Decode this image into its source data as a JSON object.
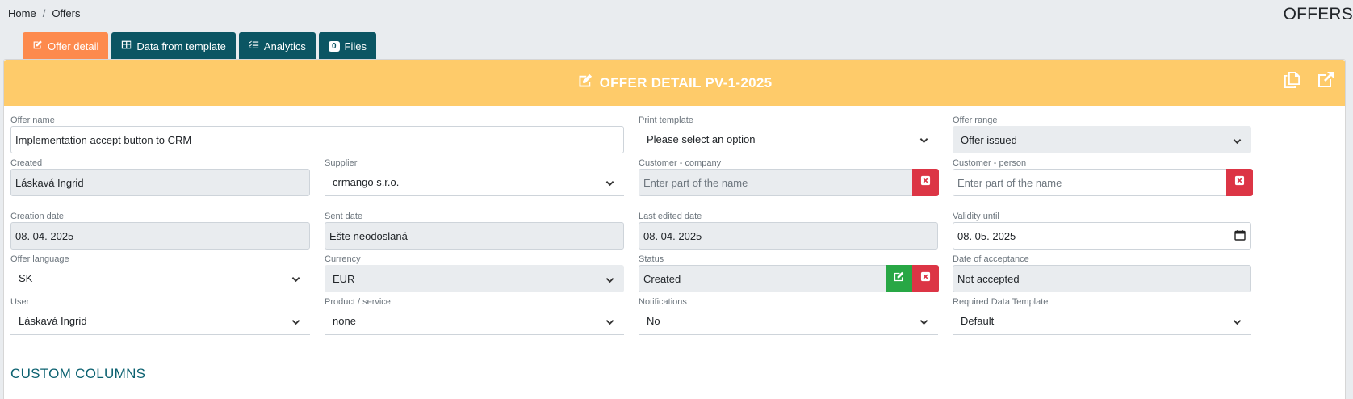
{
  "breadcrumb": {
    "home": "Home",
    "separator": "/",
    "current": "Offers"
  },
  "page_title": "OFFERS",
  "tabs": [
    {
      "label": "Offer detail",
      "icon": "edit-icon"
    },
    {
      "label": "Data from template",
      "icon": "table-icon"
    },
    {
      "label": "Analytics",
      "icon": "list-check-icon"
    },
    {
      "label": "Files",
      "badge": "0"
    }
  ],
  "card": {
    "title": "OFFER DETAIL PV-1-2025"
  },
  "fields": {
    "offer_name": {
      "label": "Offer name",
      "value": "Implementation accept button to CRM"
    },
    "print_template": {
      "label": "Print template",
      "value": "Please select an option"
    },
    "offer_range": {
      "label": "Offer range",
      "value": "Offer issued"
    },
    "created": {
      "label": "Created",
      "value": "Láskavá Ingrid"
    },
    "supplier": {
      "label": "Supplier",
      "value": "crmango s.r.o."
    },
    "customer_company": {
      "label": "Customer - company",
      "placeholder": "Enter part of the name"
    },
    "customer_person": {
      "label": "Customer - person",
      "placeholder": "Enter part of the name"
    },
    "creation_date": {
      "label": "Creation date",
      "value": "08. 04. 2025"
    },
    "sent_date": {
      "label": "Sent date",
      "value": "Ešte neodoslaná"
    },
    "last_edited_date": {
      "label": "Last edited date",
      "value": "08. 04. 2025"
    },
    "validity_until": {
      "label": "Validity until",
      "value": "08. 05. 2025"
    },
    "offer_language": {
      "label": "Offer language",
      "value": "SK"
    },
    "currency": {
      "label": "Currency",
      "value": "EUR"
    },
    "status": {
      "label": "Status",
      "value": "Created"
    },
    "date_of_acceptance": {
      "label": "Date of acceptance",
      "value": "Not accepted"
    },
    "user": {
      "label": "User",
      "value": "Láskavá Ingrid"
    },
    "product_service": {
      "label": "Product / service",
      "value": "none"
    },
    "notifications": {
      "label": "Notifications",
      "value": "No"
    },
    "required_data_template": {
      "label": "Required Data Template",
      "value": "Default"
    }
  },
  "custom_columns_title": "CUSTOM COLUMNS",
  "colors": {
    "accent_orange": "#fd8a4d",
    "tab_teal": "#0b5563",
    "header_yellow": "#fecb6a",
    "danger_red": "#dc3545",
    "success_green": "#28a745"
  }
}
